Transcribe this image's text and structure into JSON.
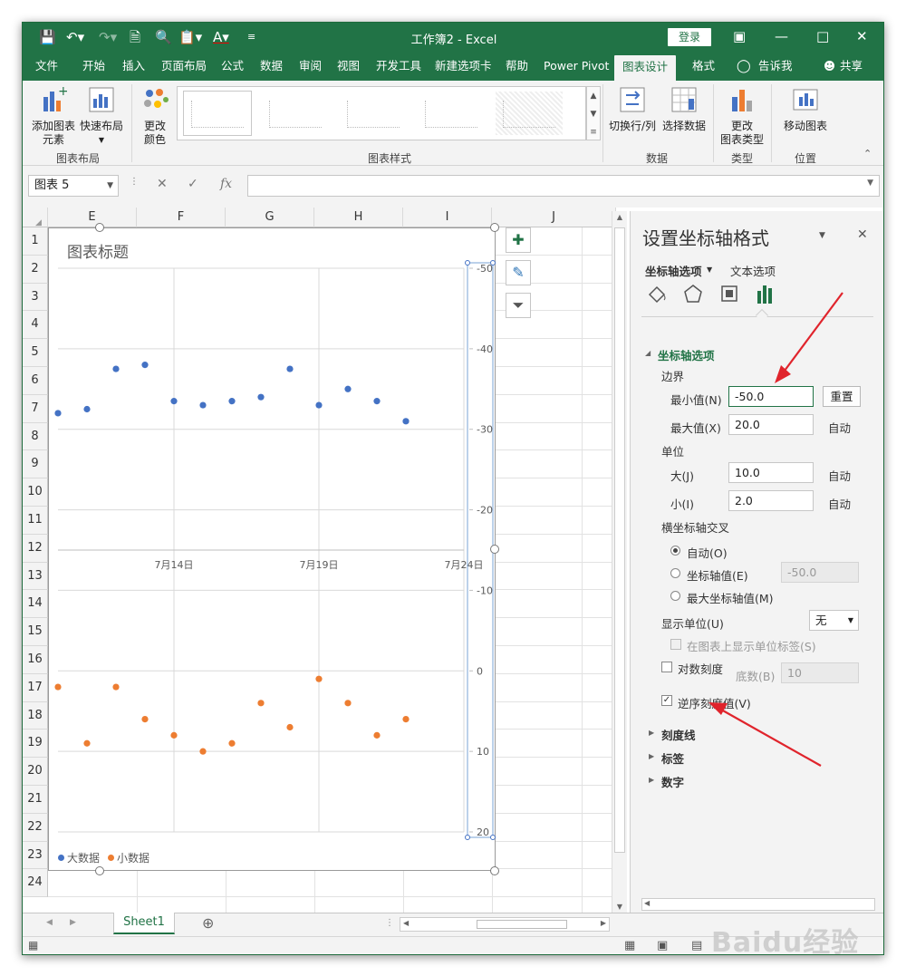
{
  "window": {
    "doc_title": "工作簿2  -  Excel",
    "login_label": "登录"
  },
  "ribbon_tabs": [
    "文件",
    "开始",
    "插入",
    "页面布局",
    "公式",
    "数据",
    "审阅",
    "视图",
    "开发工具",
    "新建选项卡",
    "帮助",
    "Power Pivot",
    "图表设计",
    "格式"
  ],
  "tell_me": "告诉我",
  "share": "共享",
  "ribbon": {
    "add_element": "添加图表\n元素",
    "quick_layout": "快速布局",
    "change_color": "更改\n颜色",
    "group_layout": "图表布局",
    "group_styles": "图表样式",
    "switch_row_col": "切换行/列",
    "select_data": "选择数据",
    "group_data": "数据",
    "change_type": "更改\n图表类型",
    "group_type": "类型",
    "move_chart": "移动图表",
    "group_location": "位置"
  },
  "formula_bar": {
    "name_box": "图表 5",
    "fx": "fx"
  },
  "columns": [
    "E",
    "F",
    "G",
    "H",
    "I",
    "J"
  ],
  "rows": [
    "1",
    "2",
    "3",
    "4",
    "5",
    "6",
    "7",
    "8",
    "9",
    "10",
    "11",
    "12",
    "13",
    "14",
    "15",
    "16",
    "17",
    "18",
    "19",
    "20",
    "21",
    "22",
    "23",
    "24"
  ],
  "chart": {
    "title": "图表标题",
    "legend": [
      "大数据",
      "小数据"
    ]
  },
  "chart_data": {
    "type": "scatter",
    "title": "图表标题",
    "x_tick_labels": [
      "7月14日",
      "7月19日",
      "7月24日"
    ],
    "y_tick_labels": [
      "-50",
      "-40",
      "-30",
      "-20",
      "-10",
      "0",
      "10",
      "20"
    ],
    "ylim": [
      -50,
      20
    ],
    "y_reversed": true,
    "legend_position": "bottom-left",
    "series": [
      {
        "name": "大数据",
        "color": "#4472c4",
        "x": [
          "7月10日",
          "7月11日",
          "7月12日",
          "7月13日",
          "7月14日",
          "7月15日",
          "7月16日",
          "7月17日",
          "7月18日",
          "7月19日",
          "7月20日",
          "7月21日",
          "7月22日"
        ],
        "y": [
          -32,
          -32.5,
          -37.5,
          -38,
          -33.5,
          -33,
          -33.5,
          -34,
          -37.5,
          -33,
          -35,
          -33.5,
          -31
        ]
      },
      {
        "name": "小数据",
        "color": "#ed7d31",
        "x": [
          "7月10日",
          "7月11日",
          "7月12日",
          "7月13日",
          "7月14日",
          "7月15日",
          "7月16日",
          "7月17日",
          "7月18日",
          "7月19日",
          "7月20日",
          "7月21日",
          "7month22日"
        ],
        "y": [
          2,
          9,
          2,
          6,
          8,
          10,
          9,
          4,
          7,
          1,
          4,
          8,
          6
        ]
      }
    ]
  },
  "sheet_tab": "Sheet1",
  "pane": {
    "title": "设置坐标轴格式",
    "tab_axis": "坐标轴选项",
    "tab_text": "文本选项",
    "sec_axis_options": "坐标轴选项",
    "bounds": "边界",
    "min_label": "最小值(N)",
    "min_value": "-50.0",
    "reset": "重置",
    "max_label": "最大值(X)",
    "max_value": "20.0",
    "auto": "自动",
    "units": "单位",
    "major_label": "大(J)",
    "major_value": "10.0",
    "minor_label": "小(I)",
    "minor_value": "2.0",
    "cross": "横坐标轴交叉",
    "cross_auto": "自动(O)",
    "cross_value": "坐标轴值(E)",
    "cross_value_box": "-50.0",
    "cross_max": "最大坐标轴值(M)",
    "display_units": "显示单位(U)",
    "display_units_value": "无",
    "show_units_label": "在图表上显示单位标签(S)",
    "log_scale": "对数刻度",
    "base_label": "底数(B)",
    "base_value": "10",
    "reverse": "逆序刻度值(V)",
    "ticks": "刻度线",
    "labels": "标签",
    "number": "数字"
  },
  "watermark": "Baidu经验"
}
